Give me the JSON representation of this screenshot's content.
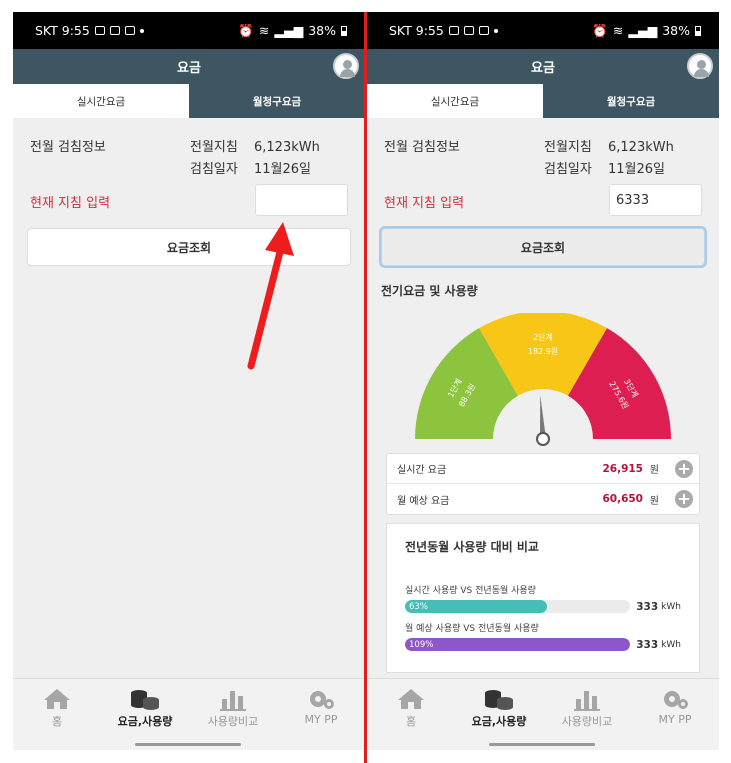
{
  "status": {
    "carrier_time": "SKT 9:55",
    "battery": "38%"
  },
  "appbar": {
    "title": "요금"
  },
  "tabs": [
    {
      "label": "실시간요금"
    },
    {
      "label": "월청구요금"
    }
  ],
  "meter_info": {
    "section_label": "전월 검침정보",
    "prev_reading_label": "전월지침",
    "prev_reading_value": "6,123kWh",
    "reading_date_label": "검침일자",
    "reading_date_value": "11월26일"
  },
  "input": {
    "label": "현재 지침 입력",
    "left_value": "",
    "right_value": "6333"
  },
  "query_button": {
    "label": "요금조회"
  },
  "usage_section": {
    "title": "전기요금 및 사용량"
  },
  "gauge": {
    "segments": [
      {
        "name": "1단계",
        "value": "88.3원",
        "color": "#8cc43e"
      },
      {
        "name": "2단계",
        "value": "182.9원",
        "color": "#f7c617"
      },
      {
        "name": "3단계",
        "value": "275.6원",
        "color": "#dc1e50"
      }
    ],
    "needle_fraction": 0.48
  },
  "fees": [
    {
      "label": "실시간 요금",
      "value": "26,915",
      "unit": "원"
    },
    {
      "label": "월 예상 요금",
      "value": "60,650",
      "unit": "원"
    }
  ],
  "compare": {
    "title": "전년동월 사용량 대비 비교",
    "rows": [
      {
        "label": "실시간 사용량 VS 전년동월 사용량",
        "percent_label": "63%",
        "fill": 0.63,
        "value": "333",
        "unit": "kWh",
        "color": "#45bfb5"
      },
      {
        "label": "월 예상 사용량 VS 전년동월 사용량",
        "percent_label": "109%",
        "fill": 1.0,
        "value": "333",
        "unit": "kWh",
        "color": "#8e57c9"
      }
    ]
  },
  "nav": [
    {
      "label": "홈"
    },
    {
      "label": "요금,사용량"
    },
    {
      "label": "사용량비교"
    },
    {
      "label": "MY PP"
    }
  ]
}
